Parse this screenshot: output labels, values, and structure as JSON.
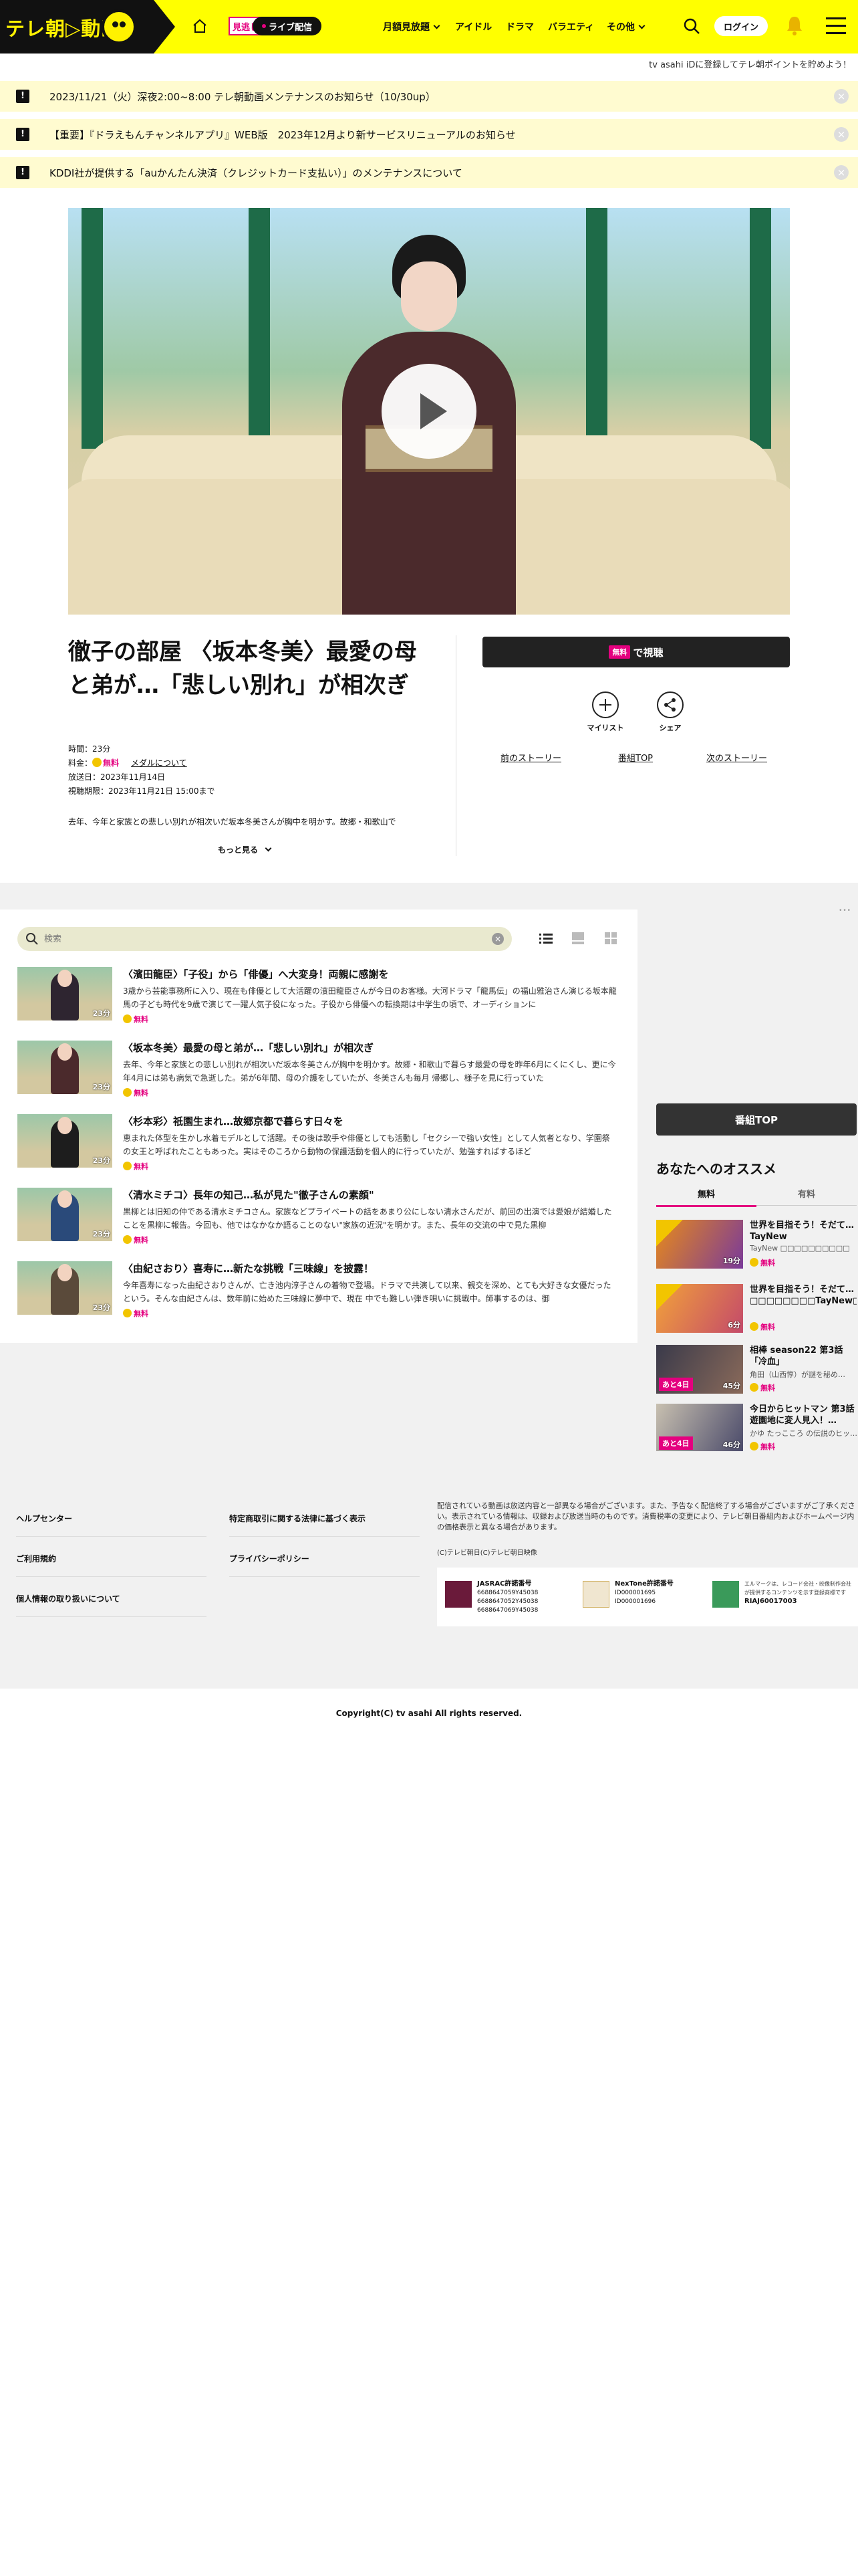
{
  "header": {
    "logo_text": "テレ朝▷動画",
    "badge_mitaoshi_a": "見逃し",
    "badge_mitaoshi_b": "無料",
    "badge_live": "ライブ配信",
    "nav": [
      "月額見放題",
      "アイドル",
      "ドラマ",
      "バラエティ",
      "その他"
    ],
    "login": "ログイン"
  },
  "tvasahi_notice": "tv asahi iDに登録してテレ朝ポイントを貯めよう！",
  "notices": [
    "2023/11/21（火）深夜2:00~8:00 テレ朝動画メンテナンスのお知らせ（10/30up）",
    "【重要】『ドラえもんチャンネルアプリ』WEB版　2023年12月より新サービスリニューアルのお知らせ",
    "KDDI社が提供する「auかんたん決済（クレジットカード支払い）」のメンテナンスについて"
  ],
  "episode": {
    "title": "徹子の部屋 〈坂本冬美〉最愛の母と弟が…「悲しい別れ」が相次ぎ",
    "duration": "時間：23分",
    "fee_label": "料金：",
    "fee_value": "無料",
    "medal_link": "メダルについて",
    "air_date": "放送日：2023年11月14日",
    "expiry": "視聴期限：2023年11月21日 15:00まで",
    "description": "去年、今年と家族との悲しい別れが相次いだ坂本冬美さんが胸中を明かす。故郷・和歌山で",
    "more": "もっと見る"
  },
  "actions": {
    "watch_tag": "無料",
    "watch_label": "で視聴",
    "mylist": "マイリスト",
    "share": "シェア",
    "prev_story": "前のストーリー",
    "program_top": "番組TOP",
    "next_story": "次のストーリー"
  },
  "list": {
    "search_placeholder": "検索",
    "items": [
      {
        "title": "〈濱田龍臣〉「子役」から「俳優」へ大変身！両親に感謝を",
        "desc": "3歳から芸能事務所に入り、現在も俳優として大活躍の濱田龍臣さんが今日のお客様。大河ドラマ「龍馬伝」の福山雅治さん演じる坂本龍馬の子ども時代を9歳で演じて一躍人気子役になった。子役から俳優への転換期は中学生の頃で、オーディションに",
        "dur": "23分",
        "free": "無料"
      },
      {
        "title": "〈坂本冬美〉最愛の母と弟が…「悲しい別れ」が相次ぎ",
        "desc": "去年、今年と家族との悲しい別れが相次いだ坂本冬美さんが胸中を明かす。故郷・和歌山で暮らす最愛の母を昨年6月にくにくし、更に今年4月には弟も病気で急逝した。弟が6年間、母の介護をしていたが、冬美さんも毎月 帰郷し、様子を見に行っていた",
        "dur": "23分",
        "free": "無料"
      },
      {
        "title": "〈杉本彩〉祇園生まれ…故郷京都で暮らす日々を",
        "desc": "恵まれた体型を生かし水着モデルとして活躍。その後は歌手や俳優としても活動し「セクシーで強い女性」として人気者となり、学園祭の女王と呼ばれたこともあった。実はそのころから動物の保護活動を個人的に行っていたが、勉強すればするほど",
        "dur": "23分",
        "free": "無料"
      },
      {
        "title": "〈清水ミチコ〉長年の知己…私が見た\"徹子さんの素顔\"",
        "desc": "黒柳とは旧知の仲である清水ミチコさん。家族などプライベートの話をあまり公にしない清水さんだが、前回の出演では愛娘が結婚したことを黒柳に報告。今回も、他ではなかなか語ることのない\"家族の近況\"を明かす。また、長年の交流の中で見た黒柳",
        "dur": "23分",
        "free": "無料"
      },
      {
        "title": "〈由紀さおり〉喜寿に…新たな挑戦「三味線」を披露！",
        "desc": "今年喜寿になった由紀さおりさんが、亡き池内淳子さんの着物で登場。ドラマで共演して以来、親交を深め、とても大好きな女優だったという。そんな由紀さんは、数年前に始めた三味線に夢中で、現在 中でも難しい弾き唄いに挑戦中。師事するのは、御",
        "dur": "23分",
        "free": "無料"
      }
    ]
  },
  "sidebar": {
    "program_top": "番組TOP",
    "reco_title": "あなたへのオススメ",
    "tabs": [
      "無料",
      "有料"
    ],
    "items": [
      {
        "title": "世界を目指そう！そだて…TayNew □□□□□□□□□□",
        "sub": "TayNew □□□□□□□□□□",
        "remain": "",
        "dur": "19分",
        "free": "無料",
        "ribbon": true
      },
      {
        "title": "世界を目指そう！そだて…□□□□□□□□TayNew□□…",
        "sub": "",
        "remain": "",
        "dur": "6分",
        "free": "無料",
        "ribbon": true
      },
      {
        "title": "相棒 season22 第3話「冷血」",
        "sub": "角田（山西惇）が謎を秘め…",
        "remain": "あと4日",
        "dur": "45分",
        "free": "無料",
        "ribbon": false
      },
      {
        "title": "今日からヒットマン 第3話 遊園地に変人見入！…",
        "sub": "かゆ たっこころ の伝説のヒッ…",
        "remain": "あと4日",
        "dur": "46分",
        "free": "無料",
        "ribbon": false
      }
    ]
  },
  "footer": {
    "col1": [
      "ヘルプセンター",
      "ご利用規約",
      "個人情報の取り扱いについて"
    ],
    "col2": [
      "特定商取引に関する法律に基づく表示",
      "プライバシーポリシー"
    ],
    "note": "配信されている動画は放送内容と一部異なる場合がございます。また、予告なく配信終了する場合がございますがご了承ください。表示されている情報は、収録および放送当時のものです。消費税率の変更により、テレビ朝日番組内およびホームページ内の価格表示と異なる場合があります。",
    "small_copy": "(C)テレビ朝日(C)テレビ朝日映像",
    "licenses": [
      {
        "name": "JASRAC許諾番号",
        "nums": "6688647059Y45038\n6688647052Y45038\n6688647069Y45038"
      },
      {
        "name": "NexTone許諾番号",
        "nums": "ID000001695\nID000001696"
      },
      {
        "name": "エルマークは、レコード会社・映像制作会社が提供するコンテンツを示す登録商標です",
        "nums": "RIAJ60017003"
      }
    ],
    "copyright": "Copyright(C) tv asahi All rights reserved."
  },
  "colors": {
    "header_bg": "#ffff00",
    "accent": "#e4007f",
    "notice_bg": "#fffbd0"
  }
}
